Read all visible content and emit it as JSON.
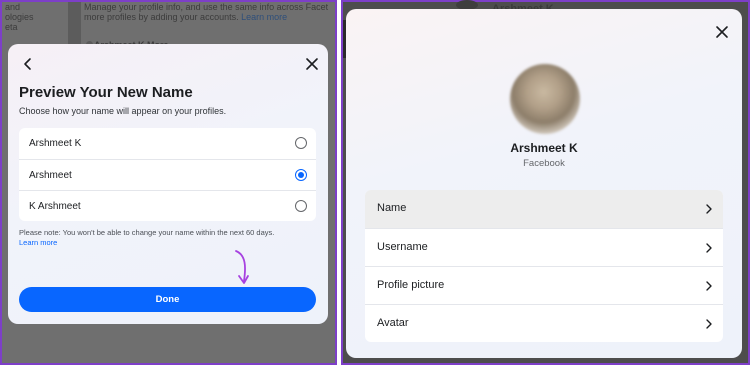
{
  "background": {
    "left_col_lines": [
      "and",
      "ologies",
      "eta"
    ],
    "center_lines": [
      "Manage your profile info, and use the same info across Facet",
      "more profiles by adding your accounts."
    ],
    "center_learn_more": "Learn more",
    "account_name_left": "Arshmeet K Mora",
    "account_name_right": "Arshmeet K"
  },
  "preview_modal": {
    "title": "Preview Your New Name",
    "subtitle": "Choose how your name will appear on your profiles.",
    "options": [
      {
        "label": "Arshmeet K",
        "selected": false
      },
      {
        "label": "Arshmeet",
        "selected": true
      },
      {
        "label": "K Arshmeet",
        "selected": false
      }
    ],
    "note": "Please note: You won't be able to change your name within the next 60 days.",
    "learn_more": "Learn more",
    "done_label": "Done",
    "icons": {
      "back": "back-arrow-icon",
      "close": "close-icon"
    },
    "colors": {
      "accent": "#0866ff",
      "annotation_arrow": "#a742e0"
    }
  },
  "profile_modal": {
    "name": "Arshmeet K",
    "platform": "Facebook",
    "menu": [
      {
        "label": "Name",
        "highlighted": true
      },
      {
        "label": "Username",
        "highlighted": false
      },
      {
        "label": "Profile picture",
        "highlighted": false
      },
      {
        "label": "Avatar",
        "highlighted": false
      }
    ],
    "icons": {
      "close": "close-icon",
      "chevron": "chevron-right-icon"
    }
  }
}
